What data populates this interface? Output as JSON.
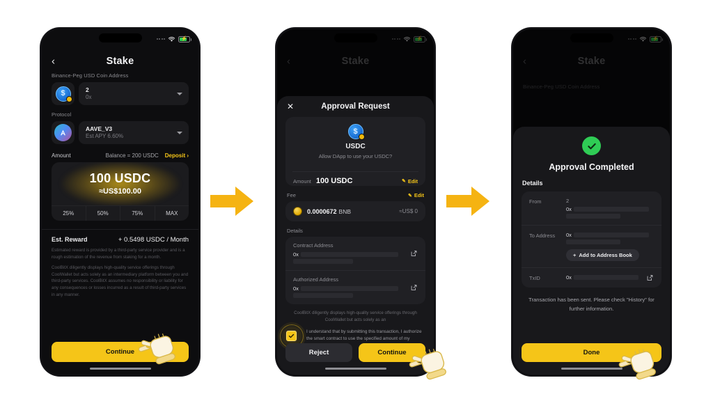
{
  "statusbar": {
    "signal": "signal-dots",
    "wifi": "wifi-icon",
    "battery": "battery-charging-icon"
  },
  "panel1": {
    "nav": {
      "back": "‹",
      "title": "Stake"
    },
    "address_section": {
      "label": "Binance-Peg USD Coin Address",
      "account_name": "2",
      "account_addr": "0x",
      "token_symbol": "$"
    },
    "protocol_section": {
      "label": "Protocol",
      "name": "AAVE_V3",
      "apy": "Est APY 6.60%"
    },
    "amount_section": {
      "label": "Amount",
      "balance": "Balance = 200 USDC",
      "deposit": "Deposit  ›",
      "value": "100 USDC",
      "usd": "≈US$100.00",
      "percents": [
        "25%",
        "50%",
        "75%",
        "MAX"
      ]
    },
    "reward": {
      "label": "Est. Reward",
      "value": "+ 0.5498 USDC / Month",
      "note1": "Estimated reward is provided by a third-party service provider and is a rough estimation of the revenue from staking for a month.",
      "note2": "CoolBitX diligently displays high-quality service offerings through CoolWallet but acts solely as an intermediary platform between you and third-party services. CoolBitX assumes no responsibility or liability for any consequences or losses incurred as a result of third-party services in any manner."
    },
    "cta": "Continue"
  },
  "panel2": {
    "nav": {
      "back": "‹",
      "title": "Stake"
    },
    "sheet": {
      "close": "✕",
      "title": "Approval Request",
      "token": {
        "symbol": "$",
        "name": "USDC",
        "prompt": "Allow DApp to use your USDC?"
      },
      "amount": {
        "label": "Amount",
        "value": "100 USDC",
        "edit": "Edit"
      },
      "fee": {
        "label": "Fee",
        "edit": "Edit",
        "value": "0.0000672",
        "unit": "BNB",
        "usd": "≈US$ 0"
      },
      "details_label": "Details",
      "contract": {
        "label": "Contract Address",
        "value": "0x"
      },
      "authorized": {
        "label": "Authorized Address",
        "value": "0x"
      },
      "disclaimer": "CoolBitX diligently displays high-quality service offerings through CoolWallet but acts solely as an",
      "ack": "I understand that by submitting this transaction, I authorize the smart contract to use the specified amount of my assets.",
      "reject": "Reject",
      "continue": "Continue"
    }
  },
  "panel3": {
    "nav": {
      "back": "‹",
      "title": "Stake"
    },
    "bg_label": "Binance-Peg USD Coin Address",
    "sheet": {
      "status_icon": "check-circle-icon",
      "title": "Approval Completed",
      "details_label": "Details",
      "from": {
        "label": "From",
        "name": "2",
        "value": "0x"
      },
      "to": {
        "label": "To Address",
        "value": "0x",
        "add_button": "Add to Address Book",
        "add_plus": "+"
      },
      "txid": {
        "label": "TxID",
        "value": "0x"
      },
      "note": "Transaction has been sent. Please check \"History\" for further information.",
      "done": "Done"
    }
  },
  "arrows": {
    "icon": "arrow-right-icon",
    "color": "#f5b312"
  },
  "cursors": {
    "icon": "pointing-hand-cursor"
  }
}
